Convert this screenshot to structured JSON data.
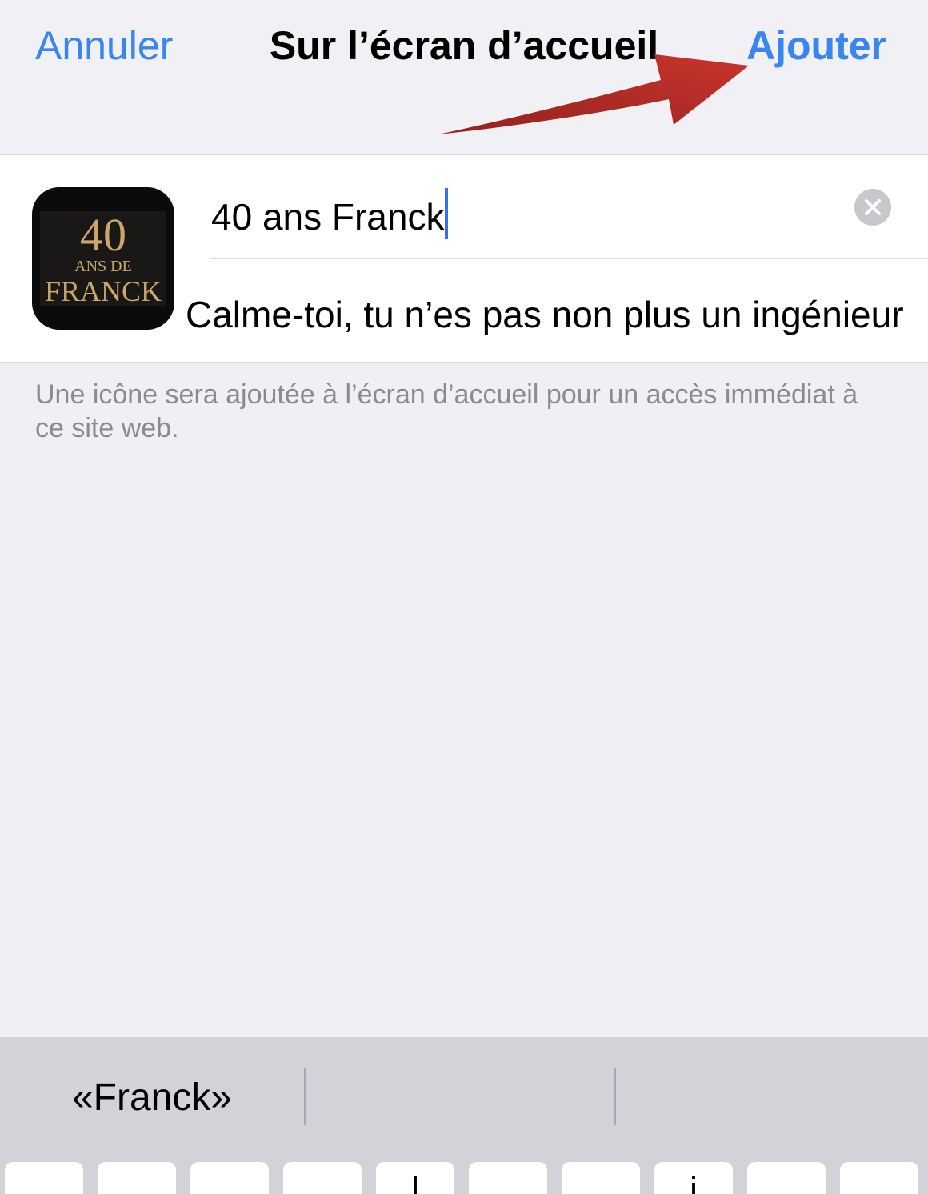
{
  "navbar": {
    "cancel_label": "Annuler",
    "title": "Sur l’écran d’accueil",
    "add_label": "Ajouter"
  },
  "colors": {
    "accent": "#3a86f0",
    "annotation_arrow": "#b3231d",
    "icon_text": "#c9a86a"
  },
  "app_icon": {
    "line1": "40",
    "line2": "ANS DE",
    "line3": "FRANCK"
  },
  "form": {
    "name_value": "40 ans Franck",
    "clear_icon": "clear-circle-icon",
    "subtitle": "Calme-toi, tu n’es pas non plus un ingénieur"
  },
  "footnote": "Une icône sera ajoutée à l’écran d’accueil pour un accès immédiat à ce site web.",
  "keyboard": {
    "suggestions": [
      "«Franck»",
      "",
      ""
    ],
    "visible_key_glyphs": [
      "",
      "",
      "",
      "",
      "l",
      "",
      "",
      "i",
      "",
      ""
    ]
  }
}
